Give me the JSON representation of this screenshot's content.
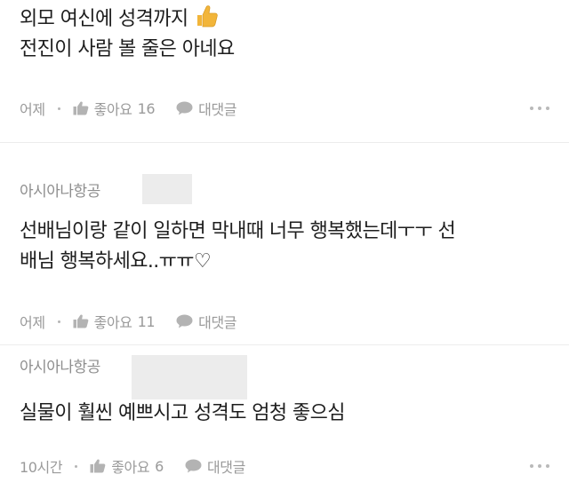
{
  "comments": [
    {
      "author": "",
      "lines": [
        "외모 여신에 성격까지",
        "전진이 사람 볼 줄은 아네요"
      ],
      "time": "어제",
      "like_label": "좋아요",
      "like_count": "16",
      "reply_label": "대댓글"
    },
    {
      "author": "아시아나항공",
      "lines": [
        "선배님이랑 같이 일하면 막내때 너무 행복했는데ㅜㅜ 선",
        "배님 행복하세요..ㅠㅠ♡"
      ],
      "time": "어제",
      "like_label": "좋아요",
      "like_count": "11",
      "reply_label": "대댓글"
    },
    {
      "author": "아시아나항공",
      "lines": [
        "실물이 훨씬 예쁘시고 성격도 엄청 좋으심"
      ],
      "time": "10시간",
      "like_label": "좋아요",
      "like_count": "6",
      "reply_label": "대댓글"
    }
  ],
  "icons": {
    "thumb_emoji": "thumbs-up-emoji",
    "like": "thumbs-up-icon",
    "reply": "speech-bubble-icon",
    "more": "more-dots-icon"
  },
  "colors": {
    "text": "#1e1e1e",
    "meta": "#9a9a9a",
    "emoji": "#f2b53a"
  }
}
